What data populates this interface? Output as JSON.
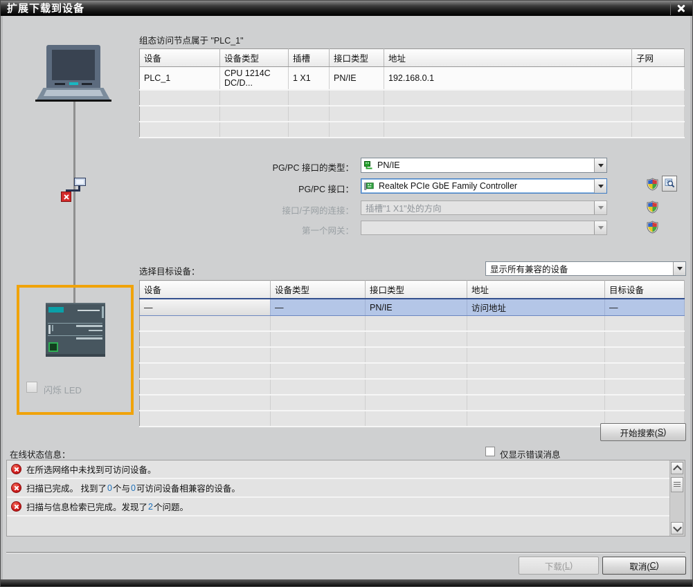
{
  "window": {
    "title": "扩展下载到设备"
  },
  "configured_nodes": {
    "label": "组态访问节点属于 \"PLC_1\"",
    "table": {
      "headers": [
        "设备",
        "设备类型",
        "插槽",
        "接口类型",
        "地址",
        "子网"
      ],
      "rows": [
        [
          "PLC_1",
          "CPU 1214C DC/D...",
          "1 X1",
          "PN/IE",
          "192.168.0.1",
          ""
        ]
      ],
      "selected_row_index": -1,
      "empty_rows": 3
    }
  },
  "pgpc_form": {
    "type_label": "PG/PC 接口的类型：",
    "type_value": "PN/IE",
    "interface_label": "PG/PC 接口：",
    "interface_value": "Realtek PCIe GbE Family Controller",
    "connection_label": "接口/子网的连接：",
    "connection_value": "插槽\"1 X1\"处的方向",
    "gateway_label": "第一个网关：",
    "gateway_value": ""
  },
  "target_section": {
    "label": "选择目标设备：",
    "filter_value": "显示所有兼容的设备",
    "table": {
      "headers": [
        "设备",
        "设备类型",
        "接口类型",
        "地址",
        "目标设备"
      ],
      "rows": [
        [
          "—",
          "—",
          "PN/IE",
          "访问地址",
          "—"
        ]
      ],
      "selected_row_index": 0,
      "empty_rows": 7
    },
    "search_button": {
      "pre": "开始搜索(",
      "key": "S",
      "post": ")"
    }
  },
  "device_panel": {
    "flash_led_label": "闪烁 LED"
  },
  "status_section": {
    "label": "在线状态信息：",
    "errors_only_label": "仅显示错误消息",
    "messages": [
      {
        "parts": [
          {
            "t": "在所选网络中未找到可访问设备。"
          }
        ]
      },
      {
        "parts": [
          {
            "t": "扫描已完成。 找到了 "
          },
          {
            "t": "0",
            "hl": true
          },
          {
            "t": " 个与 "
          },
          {
            "t": "0",
            "hl": true
          },
          {
            "t": " 可访问设备相兼容的设备。"
          }
        ]
      },
      {
        "parts": [
          {
            "t": "扫描与信息检索已完成。发现了 "
          },
          {
            "t": "2",
            "hl": true
          },
          {
            "t": " 个问题。"
          }
        ]
      }
    ]
  },
  "footer": {
    "download_button": {
      "pre": "下载(",
      "key": "L",
      "post": ")"
    },
    "cancel_button": {
      "pre": "取消(",
      "key": "C",
      "post": ")"
    }
  },
  "colors": {
    "accent_orange": "#f0a30a",
    "error_red": "#d42a2a",
    "highlight_number_blue": "#1d6fb8",
    "selected_row_blue": "#b4c6e7"
  }
}
